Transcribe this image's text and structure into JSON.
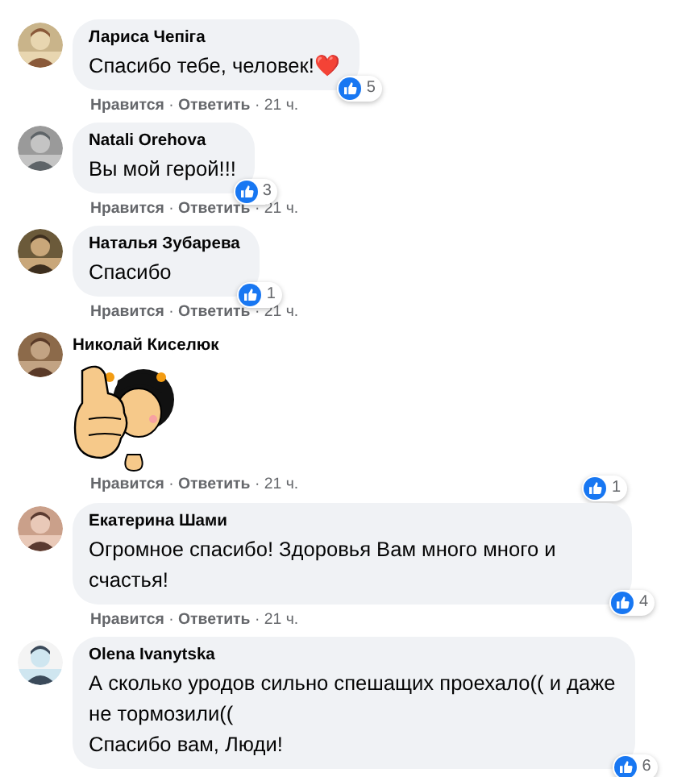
{
  "comments": [
    {
      "kind": "text",
      "author": "Лариса Чепіга",
      "lines": [
        "Спасибо тебе, человек!❤️"
      ],
      "reactions": "5",
      "actions": {
        "like": "Нравится",
        "reply": "Ответить",
        "time": "21 ч.",
        "separator": "·"
      }
    },
    {
      "kind": "text",
      "author": "Natali Orehova",
      "lines": [
        "Вы мой герой!!!"
      ],
      "reactions": "3",
      "actions": {
        "like": "Нравится",
        "reply": "Ответить",
        "time": "21 ч.",
        "separator": "·"
      }
    },
    {
      "kind": "text",
      "author": "Наталья Зубарева",
      "lines": [
        "Спасибо"
      ],
      "reactions": "1",
      "actions": {
        "like": "Нравится",
        "reply": "Ответить",
        "time": "21 ч.",
        "separator": "·"
      }
    },
    {
      "kind": "sticker",
      "author": "Николай Киселюк",
      "reactions": "1",
      "actions": {
        "like": "Нравится",
        "reply": "Ответить",
        "time": "21 ч.",
        "separator": "·"
      }
    },
    {
      "kind": "text",
      "author": "Екатерина Шами",
      "lines": [
        "Огромное спасибо! Здоровья Вам много много и",
        "счастья!"
      ],
      "reactions": "4",
      "actions": {
        "like": "Нравится",
        "reply": "Ответить",
        "time": "21 ч.",
        "separator": "·"
      }
    },
    {
      "kind": "text",
      "author": "Olena Ivanytska",
      "lines": [
        "А сколько уродов сильно спешащих проехало(( и даже",
        "не тормозили((",
        "Спасибо вам, Люди!"
      ],
      "reactions": "6"
    }
  ]
}
